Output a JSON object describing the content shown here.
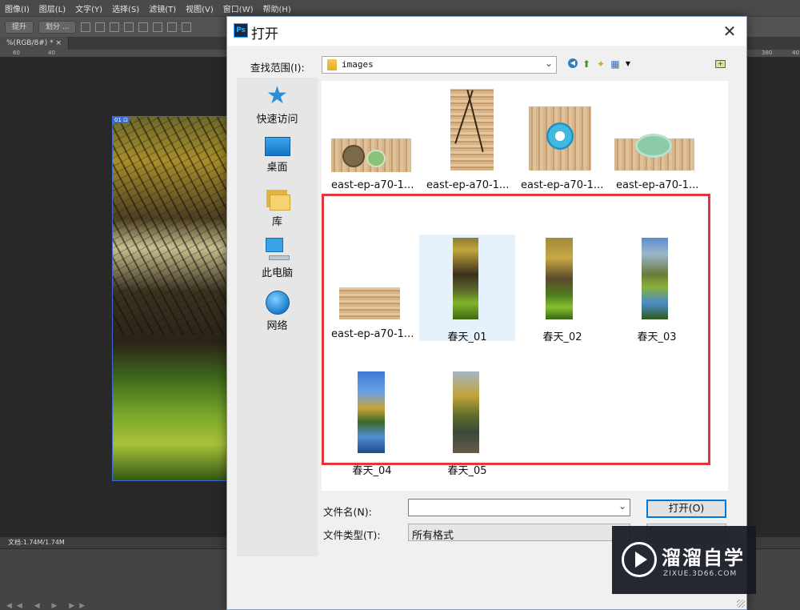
{
  "ps": {
    "menu": [
      "图像(I)",
      "图层(L)",
      "文字(Y)",
      "选择(S)",
      "滤镜(T)",
      "视图(V)",
      "窗口(W)",
      "帮助(H)"
    ],
    "opt_buttons": [
      "提升",
      "划分 ..."
    ],
    "doc_tab": "%(RGB/8#) *",
    "ruler_ticks": [
      "60",
      "40",
      "380",
      "40"
    ],
    "photo_tag": "01 ⊡",
    "status": "文档:1.74M/1.74M"
  },
  "dialog": {
    "title": "打开",
    "ps_logo": "Ps",
    "close_glyph": "✕",
    "lookin_label": "查找范围(I):",
    "lookin_value": "images",
    "places": [
      {
        "label": "快速访问",
        "icon": "star-pin-icon"
      },
      {
        "label": "桌面",
        "icon": "desktop-icon"
      },
      {
        "label": "库",
        "icon": "library-icon"
      },
      {
        "label": "此电脑",
        "icon": "computer-icon"
      },
      {
        "label": "网络",
        "icon": "network-icon"
      }
    ],
    "files": [
      {
        "name": "east-ep-a70-1..."
      },
      {
        "name": "east-ep-a70-1..."
      },
      {
        "name": "east-ep-a70-1..."
      },
      {
        "name": "east-ep-a70-1..."
      },
      {
        "name": "east-ep-a70-1..."
      },
      {
        "name": "春天_01",
        "selected": true
      },
      {
        "name": "春天_02"
      },
      {
        "name": "春天_03"
      },
      {
        "name": "春天_04"
      },
      {
        "name": "春天_05"
      }
    ],
    "filename_label": "文件名(N):",
    "filename_value": "",
    "filetype_label": "文件类型(T):",
    "filetype_value": "所有格式",
    "open_button": "打开(O)"
  },
  "watermark": {
    "title": "溜溜自学",
    "url": "ZIXUE.3D66.COM"
  },
  "colors": {
    "highlight": "#e0373d",
    "selected_bg": "#e5f1fb",
    "accent": "#0078d7"
  }
}
